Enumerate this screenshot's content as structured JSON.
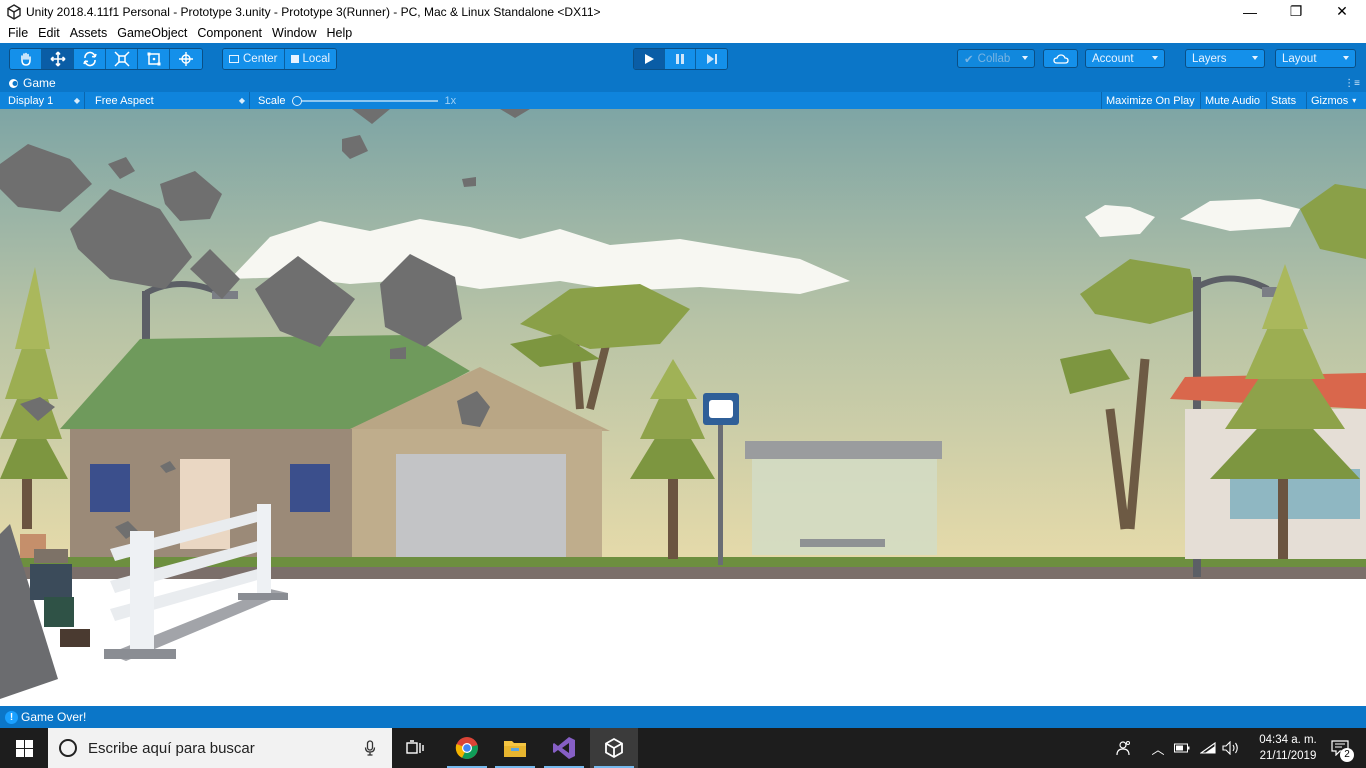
{
  "window": {
    "title": "Unity 2018.4.11f1 Personal - Prototype 3.unity - Prototype 3(Runner) - PC, Mac & Linux Standalone <DX11>",
    "controls": {
      "minimize": "—",
      "restore": "❐",
      "close": "✕"
    }
  },
  "menu": [
    "File",
    "Edit",
    "Assets",
    "GameObject",
    "Component",
    "Window",
    "Help"
  ],
  "toolbar": {
    "tools": [
      "hand-tool",
      "move-tool",
      "rotate-tool",
      "scale-tool",
      "rect-tool",
      "transform-tool"
    ],
    "active_tool": "move-tool",
    "pivot_mode": "Center",
    "pivot_rotation": "Local",
    "play_state": "playing",
    "collab_label": "Collab",
    "account_label": "Account",
    "layers_label": "Layers",
    "layout_label": "Layout"
  },
  "game_tab": {
    "title": "Game",
    "display": "Display 1",
    "aspect": "Free Aspect",
    "scale_label": "Scale",
    "scale_value": "1x",
    "scale_fraction": 0.0,
    "toggles": [
      "Maximize On Play",
      "Mute Audio",
      "Stats",
      "Gizmos"
    ]
  },
  "scene": {
    "bus_stop_sign": "bus-stop-sign",
    "sky_top": "#7ea5a5",
    "sky_bottom": "#e8dcaa",
    "ground": "#ffffff"
  },
  "status": {
    "message": "Game Over!"
  },
  "taskbar": {
    "search_placeholder": "Escribe aquí para buscar",
    "pinned": [
      "task-view-icon",
      "chrome-icon",
      "file-explorer-icon",
      "visual-studio-icon",
      "unity-icon"
    ],
    "active_app": "unity-icon",
    "time": "04:34 a. m.",
    "date": "21/11/2019",
    "notification_count": "2"
  },
  "colors": {
    "unity_blue": "#0b76c8",
    "taskbar": "#1d1d1d"
  }
}
